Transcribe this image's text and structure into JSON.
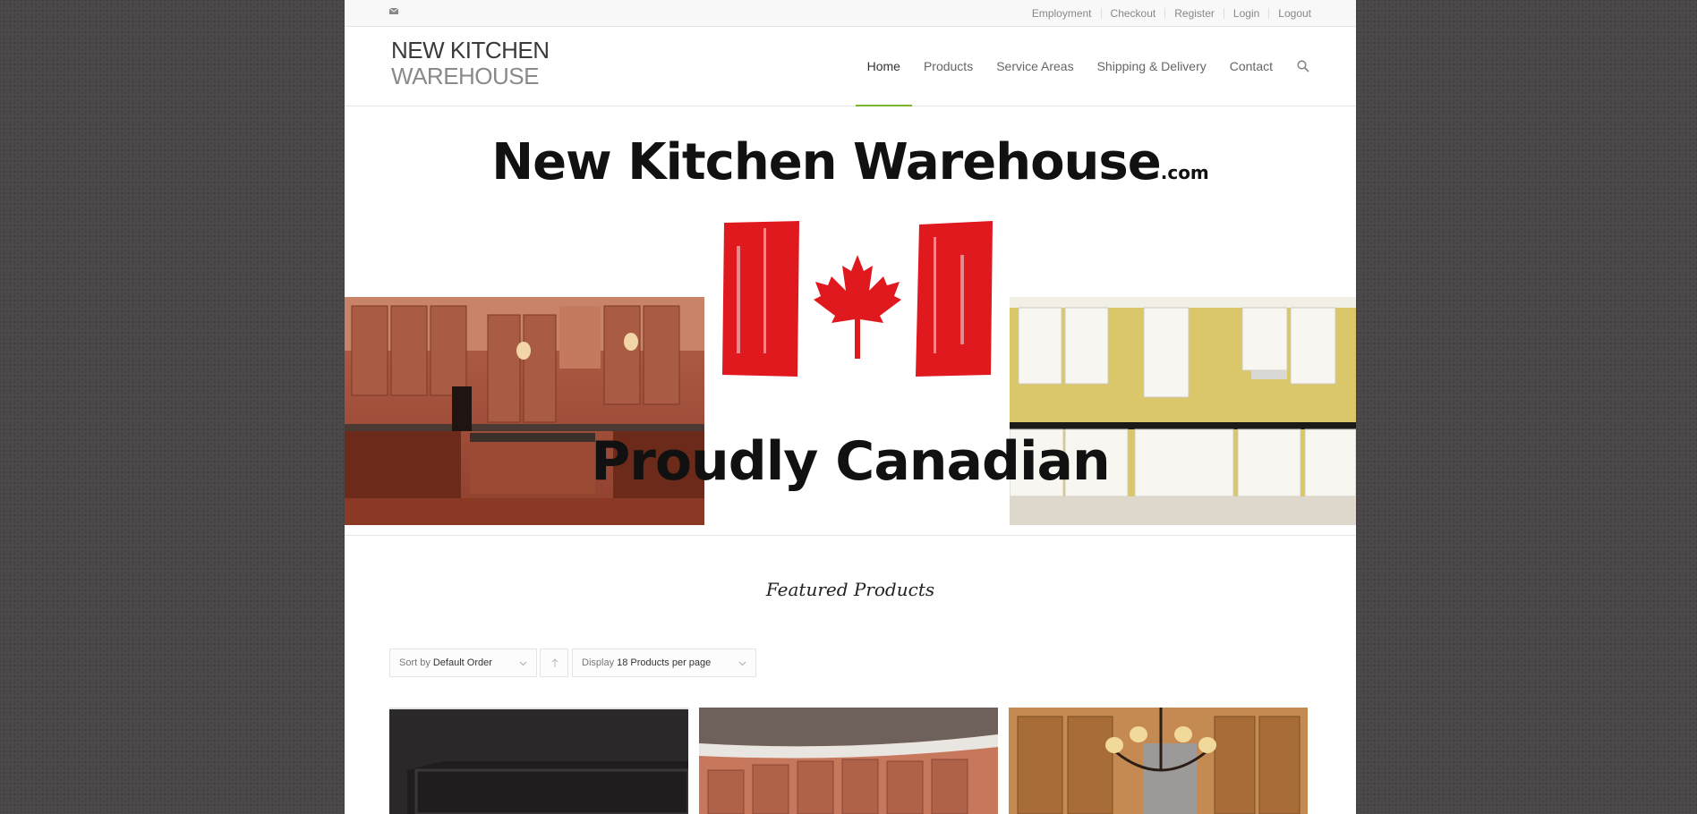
{
  "topbar": {
    "links": [
      "Employment",
      "Checkout",
      "Register",
      "Login",
      "Logout"
    ]
  },
  "logo": {
    "line1": "NEW KITCHEN",
    "line2": "WAREHOUSE"
  },
  "nav": {
    "items": [
      "Home",
      "Products",
      "Service Areas",
      "Shipping & Delivery",
      "Contact"
    ],
    "active": "Home"
  },
  "hero": {
    "brand": "New Kitchen Warehouse",
    "brand_suffix": ".com",
    "tagline": "Proudly Canadian"
  },
  "featured": {
    "title": "Featured Products",
    "sort": {
      "prefix": "Sort by",
      "value": "Default Order"
    },
    "display": {
      "prefix": "Display",
      "value": "18 Products per page"
    }
  },
  "colors": {
    "accent": "#7bb32e",
    "flag_red": "#e0191f",
    "page_bg": "#4a4647"
  },
  "icons": [
    "mail-icon",
    "search-icon",
    "chevron-down-icon",
    "arrow-up-icon"
  ]
}
